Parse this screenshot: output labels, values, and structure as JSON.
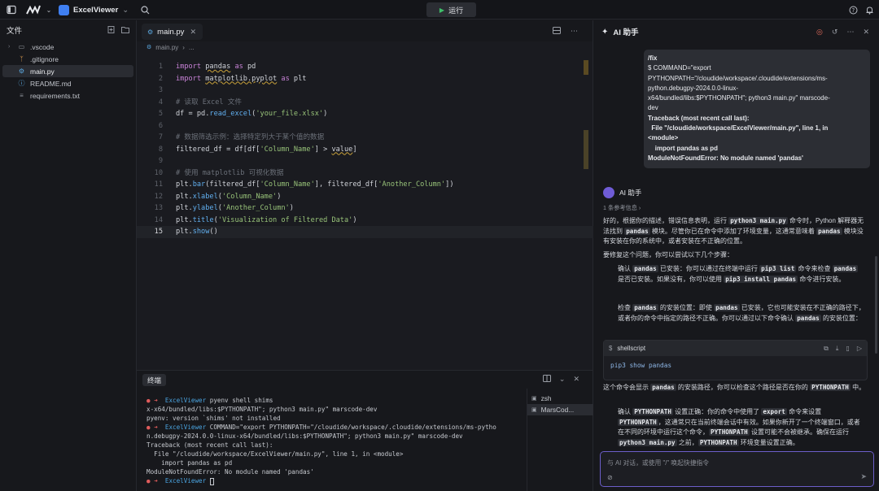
{
  "topbar": {
    "project_name": "ExcelViewer",
    "run_label": "运行"
  },
  "explorer": {
    "title": "文件",
    "items": [
      {
        "name": ".vscode",
        "icon": "folder-icon",
        "chevron": "›"
      },
      {
        "name": ".gitignore",
        "icon": "git-icon",
        "chevron": ""
      },
      {
        "name": "main.py",
        "icon": "python-icon",
        "chevron": "",
        "active": true
      },
      {
        "name": "README.md",
        "icon": "info-icon",
        "chevron": ""
      },
      {
        "name": "requirements.txt",
        "icon": "text-file-icon",
        "chevron": ""
      }
    ]
  },
  "editor": {
    "tab_label": "main.py",
    "breadcrumb_file": "main.py",
    "breadcrumb_more": "...",
    "current_line": 15
  },
  "terminal": {
    "tab_label": "终端",
    "sessions": [
      {
        "label": "zsh",
        "active": false
      },
      {
        "label": "MarsCod...",
        "active": true
      }
    ]
  },
  "ai": {
    "title": "AI 助手",
    "user_lines": [
      "/fix",
      "$ COMMAND=\"export",
      "PYTHONPATH=\"/cloudide/workspace/.cloudide/extensions/ms-",
      "python.debugpy-2024.0.0-linux-",
      "x64/bundled/libs:$PYTHONPATH\"; python3 main.py\" marscode-",
      "dev",
      "Traceback (most recent call last):",
      "  File \"/cloudide/workspace/ExcelViewer/main.py\", line 1, in",
      "<module>",
      "    import pandas as pd",
      "ModuleNotFoundError: No module named 'pandas'"
    ],
    "bot_name": "AI 助手",
    "refs": "1 条参考信息 ›",
    "code_lang": "shellscript",
    "code_text": "pip3 show pandas",
    "input_placeholder": "与 AI 对话，或使用 \"/\" 唤起快捷指令",
    "input_hint": "⊘"
  }
}
